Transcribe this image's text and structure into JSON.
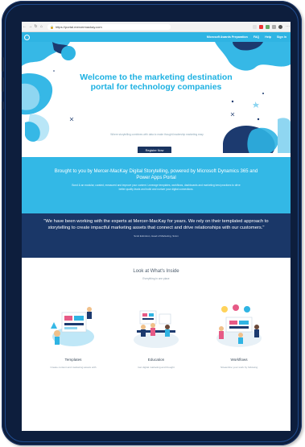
{
  "browser": {
    "url": "https://portal.mercermackay.com"
  },
  "site_nav": {
    "links": [
      "Microsoft Awards Preparation",
      "FAQ",
      "Help",
      "Sign In"
    ]
  },
  "hero": {
    "title": "Welcome to the marketing destination portal for technology companies",
    "subtitle": "Where storytelling combines with data to make thought leadership marketing easy",
    "button_label": "Register Now"
  },
  "powered": {
    "title": "Brought to you by Mercer-MacKay Digital Storytelling, powered by Microsoft Dynamics 365 and Power Apps Portal",
    "description": "Bond & an modular, curated, measured and improve your content. Leverage templates, workflows, dashboards and marketing best practices to drive better quality leads and build and nurture your digital connections."
  },
  "quote": {
    "text": "\"We have been working with the experts at Mercer-MacKay for years. We rely on their templated approach to storytelling to create impactful marketing assets that connect and drive relationships with our customers.\"",
    "author": "Scott Edmiston, Head of Marketing, Scion"
  },
  "inside": {
    "heading": "Look at What's Inside",
    "subheading": "Everything in one place",
    "cards": [
      {
        "title": "Templates",
        "desc": "Create content and marketing assets with"
      },
      {
        "title": "Education",
        "desc": "Get digital marketing and thought"
      },
      {
        "title": "Workflows",
        "desc": "Streamline your work by following"
      }
    ]
  },
  "colors": {
    "accent": "#2fb4e3",
    "navy": "#1a3768",
    "bezel": "#0d1e3d"
  }
}
